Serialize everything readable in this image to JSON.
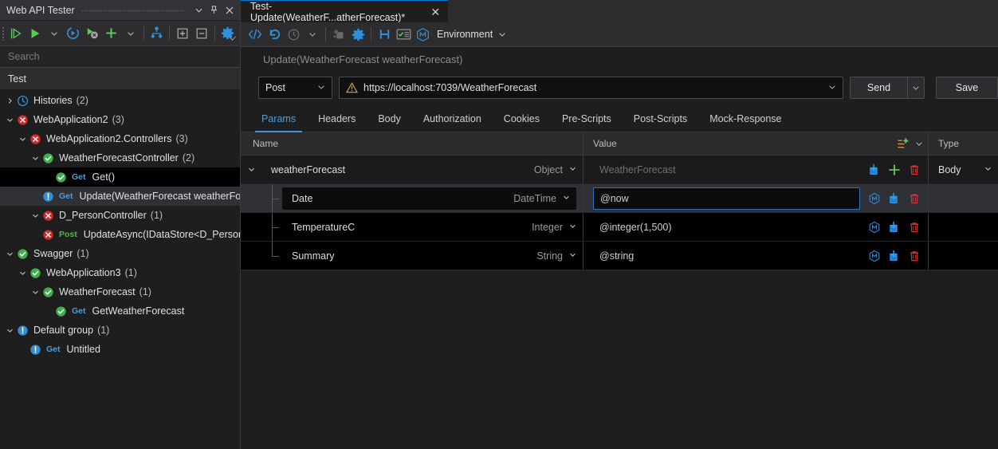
{
  "left_panel": {
    "title": "Web API Tester",
    "window_controls": [
      {
        "name": "chevron-down-icon",
        "glyph": "chevron-down"
      },
      {
        "name": "pin-icon",
        "glyph": "pin"
      },
      {
        "name": "close-icon",
        "glyph": "close"
      }
    ],
    "toolbar": [
      {
        "name": "run-step-button",
        "icon": "run-step",
        "title": "Run step"
      },
      {
        "name": "run-all-button",
        "icon": "run-all",
        "title": "Run all"
      },
      {
        "name": "run-dropdown-caret",
        "icon": "chevron-down",
        "title": "Run options"
      },
      {
        "name": "reload-button",
        "icon": "refresh-circle",
        "title": "Reload"
      },
      {
        "name": "stop-button",
        "icon": "run-stop",
        "title": "Stop"
      },
      {
        "name": "add-button",
        "icon": "plus",
        "title": "Add"
      },
      {
        "name": "add-dropdown-caret",
        "icon": "chevron-down",
        "title": "Add options"
      },
      {
        "name": "sitemap-button",
        "icon": "sitemap",
        "title": "Hierarchy"
      },
      {
        "name": "expand-all-button",
        "icon": "expand-all",
        "title": "Expand all"
      },
      {
        "name": "collapse-all-button",
        "icon": "collapse-all",
        "title": "Collapse all"
      },
      {
        "name": "settings-button",
        "icon": "gear",
        "title": "Settings"
      }
    ],
    "search": {
      "placeholder": "Search",
      "value": ""
    },
    "group_header": "Test",
    "tree": [
      {
        "indent": 0,
        "twisty": "collapsed",
        "icon": "clock-blue",
        "label": "Histories",
        "count": "(2)",
        "verb": "",
        "state": "normal"
      },
      {
        "indent": 0,
        "twisty": "expanded",
        "icon": "error-red",
        "label": "WebApplication2",
        "count": "(3)",
        "verb": "",
        "state": "normal"
      },
      {
        "indent": 1,
        "twisty": "expanded",
        "icon": "error-red",
        "label": "WebApplication2.Controllers",
        "count": "(3)",
        "verb": "",
        "state": "normal"
      },
      {
        "indent": 2,
        "twisty": "expanded",
        "icon": "check-green",
        "label": "WeatherForecastController",
        "count": "(2)",
        "verb": "",
        "state": "normal"
      },
      {
        "indent": 3,
        "twisty": "none",
        "icon": "check-green",
        "label": "Get()",
        "count": "",
        "verb": "Get",
        "verb_kind": "get",
        "state": "active"
      },
      {
        "indent": 3,
        "twisty": "none",
        "icon": "info-blue",
        "label": "Update(WeatherForecast weatherFore",
        "count": "",
        "verb": "Get",
        "verb_kind": "get",
        "state": "selected"
      },
      {
        "indent": 2,
        "twisty": "expanded",
        "icon": "error-red",
        "label": "D_PersonController",
        "count": "(1)",
        "verb": "",
        "state": "normal"
      },
      {
        "indent": 3,
        "twisty": "none",
        "icon": "error-red",
        "label": "UpdateAsync(IDataStore<D_Person> ",
        "count": "",
        "verb": "Post",
        "verb_kind": "post",
        "state": "normal"
      },
      {
        "indent": 0,
        "twisty": "expanded",
        "icon": "check-green",
        "label": "Swagger",
        "count": "(1)",
        "verb": "",
        "state": "normal"
      },
      {
        "indent": 1,
        "twisty": "expanded",
        "icon": "check-green",
        "label": "WebApplication3",
        "count": "(1)",
        "verb": "",
        "state": "normal"
      },
      {
        "indent": 2,
        "twisty": "expanded",
        "icon": "check-green",
        "label": "WeatherForecast",
        "count": "(1)",
        "verb": "",
        "state": "normal"
      },
      {
        "indent": 3,
        "twisty": "none",
        "icon": "check-green",
        "label": "GetWeatherForecast",
        "count": "",
        "verb": "Get",
        "verb_kind": "get",
        "state": "normal"
      },
      {
        "indent": 0,
        "twisty": "expanded",
        "icon": "info-blue",
        "label": "Default group",
        "count": "(1)",
        "verb": "",
        "state": "normal"
      },
      {
        "indent": 1,
        "twisty": "none",
        "icon": "info-blue",
        "label": "Untitled",
        "count": "",
        "verb": "Get",
        "verb_kind": "get",
        "state": "normal"
      }
    ]
  },
  "document_tab": {
    "label": "Test-Update(WeatherF...atherForecast)*",
    "close_glyph": "✕"
  },
  "request_toolbar": {
    "items": [
      {
        "name": "code-view-button",
        "icon": "code"
      },
      {
        "name": "undo-button",
        "icon": "undo"
      },
      {
        "name": "history-button",
        "icon": "clock"
      },
      {
        "name": "history-caret",
        "icon": "chevron-down"
      },
      {
        "name": "plugin-button",
        "icon": "plugin"
      },
      {
        "name": "settings-button",
        "icon": "gear"
      },
      {
        "name": "header-button",
        "icon": "letter-h"
      },
      {
        "name": "checklist-button",
        "icon": "checklist"
      },
      {
        "name": "mock-button",
        "icon": "mock-hex"
      }
    ],
    "environment_label": "Environment",
    "environment_caret": "⌄"
  },
  "request": {
    "title": "Update(WeatherForecast weatherForecast)",
    "method": "Post",
    "method_caret": "⌄",
    "url": "https://localhost:7039/WeatherForecast",
    "url_warning_icon": "warning-triangle",
    "url_caret": "⌄",
    "send_label": "Send",
    "send_caret": "⌄",
    "save_label": "Save"
  },
  "sub_tabs": [
    {
      "label": "Params",
      "active": true
    },
    {
      "label": "Headers",
      "active": false
    },
    {
      "label": "Body",
      "active": false
    },
    {
      "label": "Authorization",
      "active": false
    },
    {
      "label": "Cookies",
      "active": false
    },
    {
      "label": "Pre-Scripts",
      "active": false
    },
    {
      "label": "Post-Scripts",
      "active": false
    },
    {
      "label": "Mock-Response",
      "active": false
    }
  ],
  "params_table": {
    "headers": {
      "name": "Name",
      "value": "Value",
      "type": "Type"
    },
    "value_header_actions": [
      {
        "name": "add-row-icon",
        "icon": "list-plus"
      },
      {
        "name": "value-options-caret",
        "icon": "chevron-down"
      }
    ],
    "rows": [
      {
        "level": 0,
        "twisty": "expanded",
        "name": "weatherForecast",
        "type": "Object",
        "value": "WeatherForecast",
        "value_is_placeholder": true,
        "value_focused": false,
        "name_boxed": false,
        "type_column": "Body",
        "type_column_caret": "⌄",
        "actions": [
          {
            "name": "import-icon",
            "icon": "import-blue"
          },
          {
            "name": "add-icon",
            "icon": "plus-green"
          },
          {
            "name": "delete-icon",
            "icon": "trash-red"
          }
        ]
      },
      {
        "level": 1,
        "twisty": "none",
        "connector": "mid",
        "name": "Date",
        "type": "DateTime",
        "value": "@now",
        "value_is_placeholder": false,
        "value_focused": true,
        "name_boxed": true,
        "type_column": "",
        "actions": [
          {
            "name": "mock-icon",
            "icon": "mock-hex"
          },
          {
            "name": "import-icon",
            "icon": "import-blue"
          },
          {
            "name": "delete-icon",
            "icon": "trash-red"
          }
        ]
      },
      {
        "level": 1,
        "twisty": "none",
        "connector": "mid",
        "name": "TemperatureC",
        "type": "Integer",
        "value": "@integer(1,500)",
        "value_is_placeholder": false,
        "value_focused": false,
        "name_boxed": false,
        "type_column": "",
        "actions": [
          {
            "name": "mock-icon",
            "icon": "mock-hex"
          },
          {
            "name": "import-icon",
            "icon": "import-blue"
          },
          {
            "name": "delete-icon",
            "icon": "trash-red"
          }
        ]
      },
      {
        "level": 1,
        "twisty": "none",
        "connector": "last",
        "name": "Summary",
        "type": "String",
        "value": "@string",
        "value_is_placeholder": false,
        "value_focused": false,
        "name_boxed": false,
        "type_column": "",
        "actions": [
          {
            "name": "mock-icon",
            "icon": "mock-hex"
          },
          {
            "name": "import-icon",
            "icon": "import-blue"
          },
          {
            "name": "delete-icon",
            "icon": "trash-red"
          }
        ]
      }
    ]
  },
  "colors": {
    "accent_blue": "#4a9ede",
    "success_green": "#4caf50",
    "error_red": "#e03030",
    "info_blue": "#2f8fd8",
    "warning_amber": "#d7a24a",
    "tab_underline": "#4a8fe0"
  }
}
